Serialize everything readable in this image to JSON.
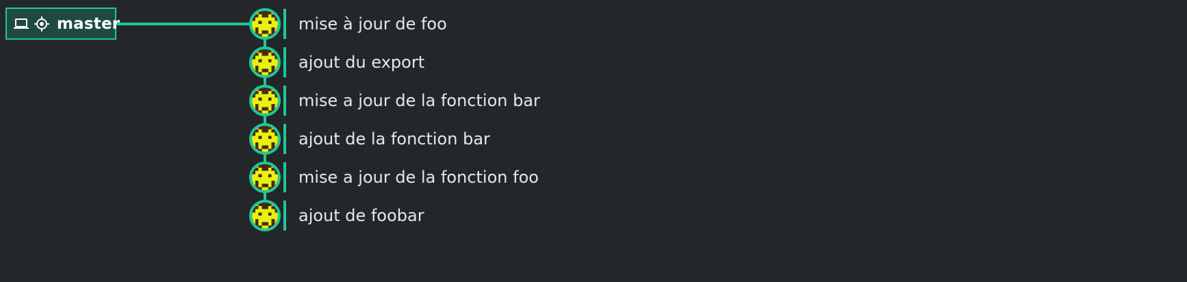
{
  "branch": {
    "name": "master",
    "icons": [
      "laptop-icon",
      "target-icon"
    ]
  },
  "commits": [
    {
      "message": "mise à jour de foo",
      "avatar": "pixel-invader-avatar"
    },
    {
      "message": "ajout du export",
      "avatar": "pixel-invader-avatar"
    },
    {
      "message": "mise a jour de la fonction bar",
      "avatar": "pixel-invader-avatar"
    },
    {
      "message": "ajout de la fonction bar",
      "avatar": "pixel-invader-avatar"
    },
    {
      "message": "mise a jour de la fonction foo",
      "avatar": "pixel-invader-avatar"
    },
    {
      "message": "ajout de foobar",
      "avatar": "pixel-invader-avatar"
    }
  ],
  "colors": {
    "background": "#232729",
    "accent": "#1ec995",
    "branch_fill": "#1f4a40",
    "text": "#e6e8e8",
    "avatar_dark": "#4a2816",
    "avatar_light": "#e6f20c"
  }
}
